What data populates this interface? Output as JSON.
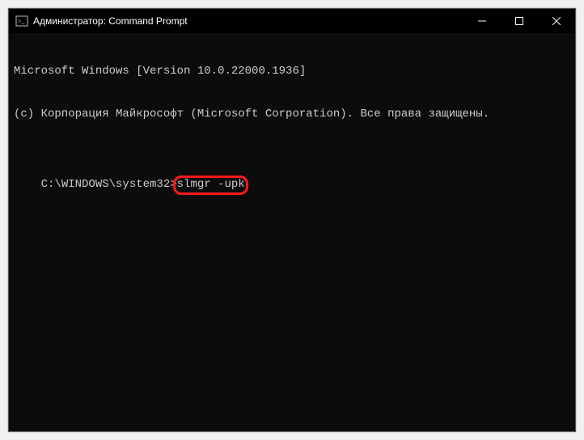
{
  "titlebar": {
    "title": "Администратор: Command Prompt"
  },
  "terminal": {
    "line1": "Microsoft Windows [Version 10.0.22000.1936]",
    "line2": "(c) Корпорация Майкрософт (Microsoft Corporation). Все права защищены.",
    "prompt_path": "C:\\WINDOWS\\system32>",
    "command": "slmgr -upk"
  }
}
